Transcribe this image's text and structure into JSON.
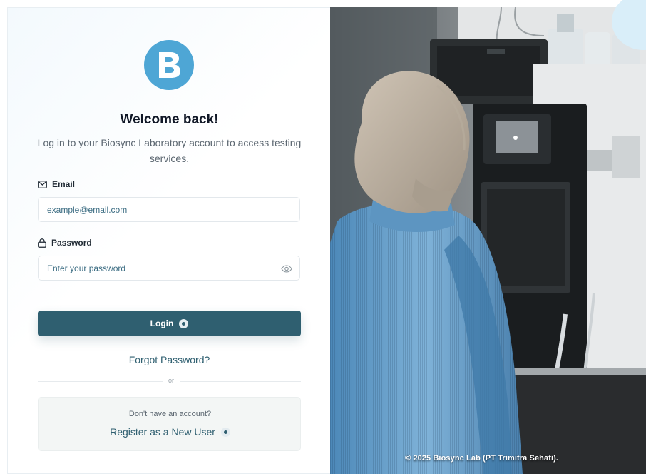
{
  "login": {
    "title": "Welcome back!",
    "subtitle": "Log in to your Biosync Laboratory account to access testing services.",
    "email": {
      "label": "Email",
      "placeholder": "example@email.com",
      "value": "",
      "icon": "mail-icon"
    },
    "password": {
      "label": "Password",
      "placeholder": "Enter your password",
      "value": "",
      "icon": "lock-icon",
      "toggle_icon": "eye-icon"
    },
    "login_button": "Login",
    "forgot_password": "Forgot Password?",
    "divider_text": "or",
    "register": {
      "question": "Don't have an account?",
      "link": "Register as a New User"
    }
  },
  "logo": {
    "letter": "B",
    "color": "#4ea6d5"
  },
  "hero": {
    "copyright": "© 2025 Biosync Lab (PT Trimitra Sehati)."
  },
  "colors": {
    "primary": "#2f5f70",
    "accent": "#4ea6d5",
    "placeholder": "#3b6c82"
  }
}
